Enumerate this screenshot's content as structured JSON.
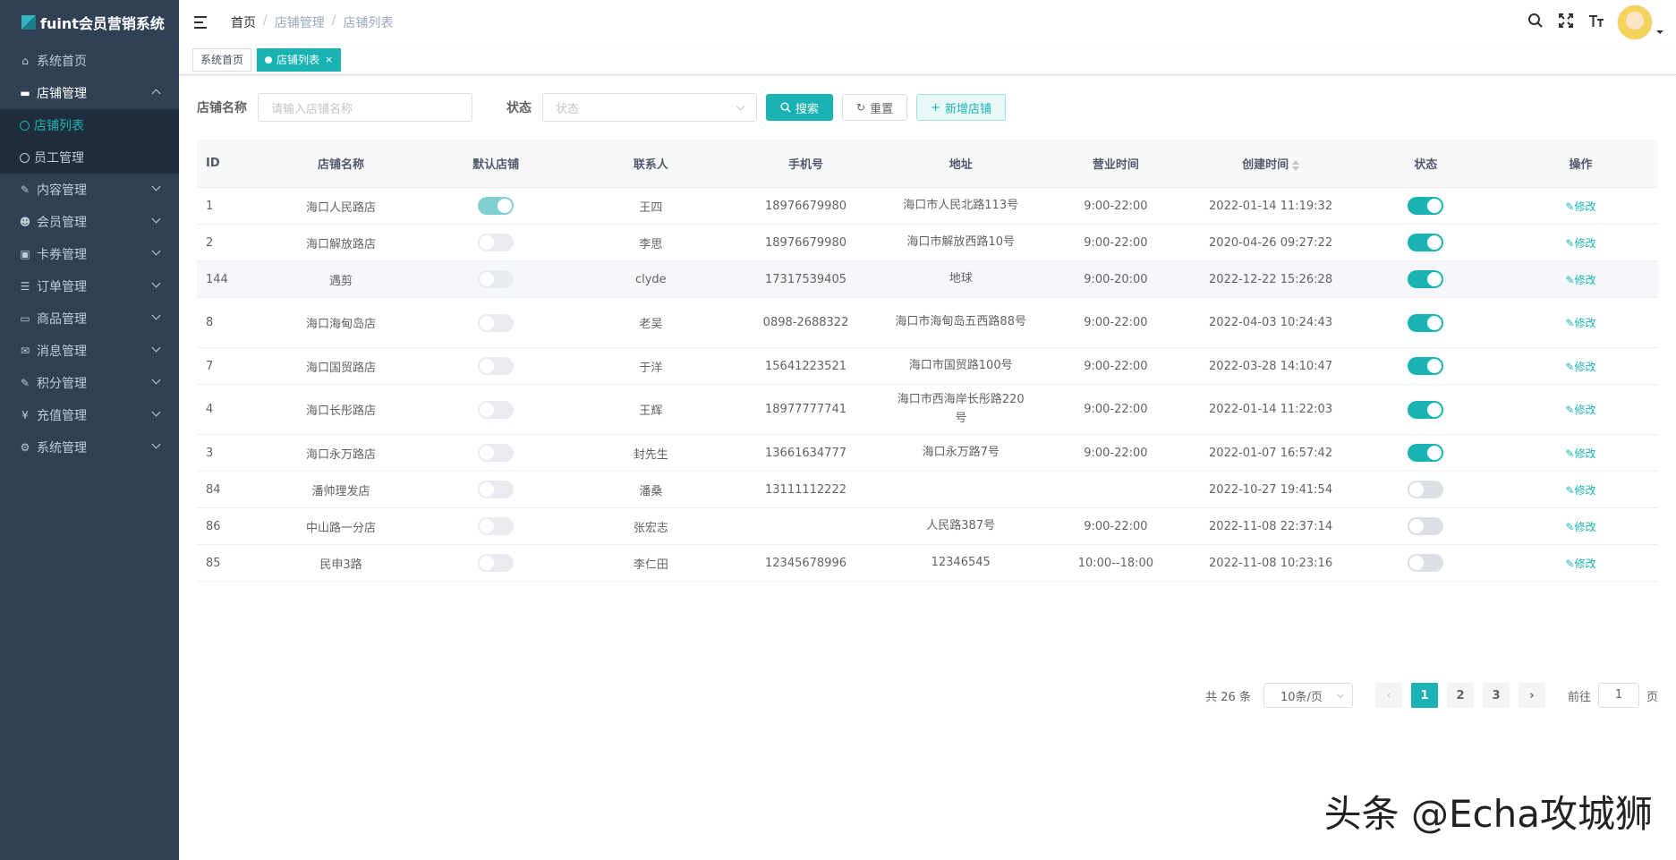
{
  "app": {
    "logo_text": "fuint会员营销系统"
  },
  "sidebar": {
    "items": [
      {
        "label": "系统首页",
        "icon": "dashboard-icon",
        "glyph": "⌂",
        "expandable": false
      },
      {
        "label": "店铺管理",
        "icon": "cart-icon",
        "glyph": "▬",
        "expandable": true,
        "open": true,
        "children": [
          {
            "label": "店铺列表",
            "active": true
          },
          {
            "label": "员工管理",
            "active": false
          }
        ]
      },
      {
        "label": "内容管理",
        "icon": "edit-icon",
        "glyph": "✎",
        "expandable": true
      },
      {
        "label": "会员管理",
        "icon": "users-icon",
        "glyph": "☻",
        "expandable": true
      },
      {
        "label": "卡券管理",
        "icon": "coupon-icon",
        "glyph": "▣",
        "expandable": true
      },
      {
        "label": "订单管理",
        "icon": "list-icon",
        "glyph": "☰",
        "expandable": true
      },
      {
        "label": "商品管理",
        "icon": "monitor-icon",
        "glyph": "▭",
        "expandable": true
      },
      {
        "label": "消息管理",
        "icon": "message-icon",
        "glyph": "✉",
        "expandable": true
      },
      {
        "label": "积分管理",
        "icon": "points-icon",
        "glyph": "✎",
        "expandable": true
      },
      {
        "label": "充值管理",
        "icon": "yen-icon",
        "glyph": "¥",
        "expandable": true
      },
      {
        "label": "系统管理",
        "icon": "gear-icon",
        "glyph": "⚙",
        "expandable": true
      }
    ]
  },
  "breadcrumb": [
    "首页",
    "店铺管理",
    "店铺列表"
  ],
  "breadcrumb_sep": "/",
  "tags": [
    {
      "label": "系统首页",
      "active": false
    },
    {
      "label": "店铺列表",
      "active": true,
      "close": "×"
    }
  ],
  "filter": {
    "name_label": "店铺名称",
    "name_placeholder": "请输入店铺名称",
    "status_label": "状态",
    "status_placeholder": "状态",
    "search_label": "搜索",
    "reset_label": "重置",
    "add_label": "新增店铺"
  },
  "table": {
    "columns": [
      "ID",
      "店铺名称",
      "默认店铺",
      "联系人",
      "手机号",
      "地址",
      "营业时间",
      "创建时间",
      "状态",
      "操作"
    ],
    "edit_label": "修改",
    "rows": [
      {
        "id": "1",
        "name": "海口人民路店",
        "is_default": true,
        "contact": "王四",
        "phone": "18976679980",
        "address": "海口市人民北路113号",
        "hours": "9:00-22:00",
        "created": "2022-01-14 11:19:32",
        "status": true,
        "height": 41
      },
      {
        "id": "2",
        "name": "海口解放路店",
        "is_default": false,
        "contact": "李思",
        "phone": "18976679980",
        "address": "海口市解放西路10号",
        "hours": "9:00-22:00",
        "created": "2020-04-26 09:27:22",
        "status": true,
        "height": 41
      },
      {
        "id": "144",
        "name": "遇剪",
        "is_default": false,
        "contact": "clyde",
        "phone": "17317539405",
        "address": "地球",
        "hours": "9:00-20:00",
        "created": "2022-12-22 15:26:28",
        "status": true,
        "height": 41,
        "highlight": true
      },
      {
        "id": "8",
        "name": "海口海甸岛店",
        "is_default": false,
        "contact": "老吴",
        "phone": "0898-2688322",
        "address": "海口市海甸岛五西路88号",
        "hours": "9:00-22:00",
        "created": "2022-04-03 10:24:43",
        "status": true,
        "height": 56
      },
      {
        "id": "7",
        "name": "海口国贸路店",
        "is_default": false,
        "contact": "于洋",
        "phone": "15641223521",
        "address": "海口市国贸路100号",
        "hours": "9:00-22:00",
        "created": "2022-03-28 14:10:47",
        "status": true,
        "height": 41
      },
      {
        "id": "4",
        "name": "海口长彤路店",
        "is_default": false,
        "contact": "王辉",
        "phone": "18977777741",
        "address": "海口市西海岸长彤路220号",
        "hours": "9:00-22:00",
        "created": "2022-01-14 11:22:03",
        "status": true,
        "height": 56
      },
      {
        "id": "3",
        "name": "海口永万路店",
        "is_default": false,
        "contact": "封先生",
        "phone": "13661634777",
        "address": "海口永万路7号",
        "hours": "9:00-22:00",
        "created": "2022-01-07 16:57:42",
        "status": true,
        "height": 41
      },
      {
        "id": "84",
        "name": "潘帅理发店",
        "is_default": false,
        "contact": "潘桑",
        "phone": "13111112222",
        "address": "",
        "hours": "",
        "created": "2022-10-27 19:41:54",
        "status": false,
        "height": 41
      },
      {
        "id": "86",
        "name": "中山路一分店",
        "is_default": false,
        "contact": "张宏志",
        "phone": "",
        "address": "人民路387号",
        "hours": "9:00-22:00",
        "created": "2022-11-08 22:37:14",
        "status": false,
        "height": 41
      },
      {
        "id": "85",
        "name": "民申3路",
        "is_default": false,
        "contact": "李仁田",
        "phone": "12345678996",
        "address": "12346545",
        "hours": "10:00--18:00",
        "created": "2022-11-08 10:23:16",
        "status": false,
        "height": 41
      }
    ]
  },
  "pagination": {
    "total_text": "共 26 条",
    "page_size": "10条/页",
    "pages": [
      "1",
      "2",
      "3"
    ],
    "current": "1",
    "prev": "‹",
    "next": "›",
    "goto_label": "前往",
    "goto_value": "1",
    "goto_suffix": "页"
  },
  "colors": {
    "accent": "#1ab3b3",
    "sidebar_bg": "#304156",
    "submenu_bg": "#1f2d3d"
  },
  "watermark": "头条 @Echa攻城狮"
}
